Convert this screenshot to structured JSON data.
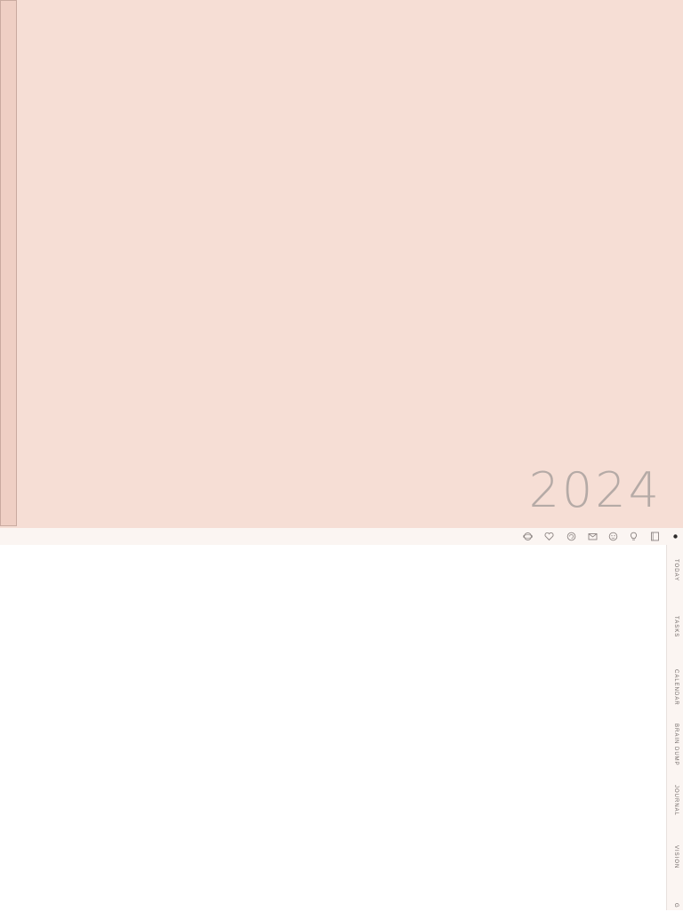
{
  "cover": {
    "year": "2024",
    "background_color": "#f6ded5",
    "spine_color": "#efcfc4"
  },
  "toolbar": {
    "icons": [
      "planet-icon",
      "heart-icon",
      "swirl-icon",
      "envelope-icon",
      "face-icon",
      "lightbulb-icon",
      "notebook-icon",
      "dot-icon"
    ]
  },
  "side_tabs": {
    "today": "TODAY",
    "tasks": "TASKS",
    "calendar": "CALENDAR",
    "brain_dump": "BRAIN DUMP",
    "journal": "JOURNAL",
    "vision": "VISION",
    "goals": "G"
  }
}
